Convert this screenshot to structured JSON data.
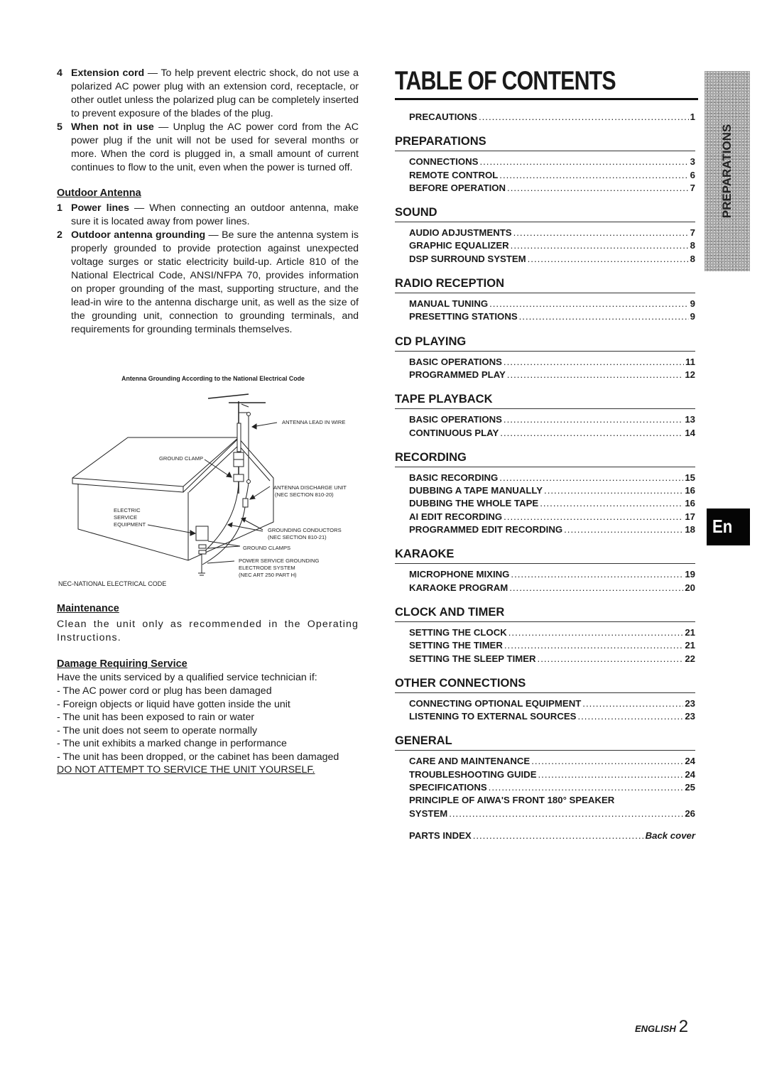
{
  "left": {
    "safety_items": [
      {
        "num": "4",
        "title": "Extension cord",
        "text": " — To help prevent electric shock, do not use a polarized AC power plug with an extension cord, receptacle, or other outlet unless the polarized plug can be completely inserted to prevent exposure of the blades of the plug."
      },
      {
        "num": "5",
        "title": "When not in use",
        "text": " — Unplug the AC power cord from the AC power plug if the unit will not be used for several months or more.  When the cord is plugged in, a small amount of current continues to flow to the unit, even when the power is turned off."
      }
    ],
    "outdoor_antenna": {
      "heading": "Outdoor Antenna",
      "items": [
        {
          "num": "1",
          "title": "Power lines",
          "text": " — When connecting an outdoor antenna, make sure it is located away from power lines."
        },
        {
          "num": "2",
          "title": "Outdoor antenna grounding",
          "text": " — Be sure the antenna system is properly grounded to provide protection against unexpected voltage surges or static electricity build-up.  Article 810 of the National Electrical Code, ANSI/NFPA 70, provides information on proper grounding of the mast, supporting structure, and the lead-in wire to the antenna discharge unit, as well as the size of the grounding unit, connection to grounding terminals, and requirements for grounding terminals themselves."
        }
      ]
    },
    "diagram": {
      "caption": "Antenna Grounding According to the National Electrical Code",
      "labels": {
        "lead_in": "ANTENNA LEAD IN WIRE",
        "ground_clamp": "GROUND CLAMP",
        "discharge_unit_1": "ANTENNA DISCHARGE UNIT",
        "discharge_unit_2": "(NEC SECTION 810-20)",
        "electric_1": "ELECTRIC",
        "electric_2": "SERVICE",
        "electric_3": "EQUIPMENT",
        "conductors_1": "GROUNDING CONDUCTORS",
        "conductors_2": "(NEC SECTION 810-21)",
        "ground_clamps": "GROUND CLAMPS",
        "electrode_1": "POWER SERVICE GROUNDING",
        "electrode_2": "ELECTRODE SYSTEM",
        "electrode_3": "(NEC ART 250 PART H)",
        "nec": "NEC-NATIONAL ELECTRICAL CODE"
      }
    },
    "maintenance": {
      "heading": "Maintenance",
      "text": "Clean the unit only as recommended in the Operating Instructions."
    },
    "damage": {
      "heading": "Damage Requiring Service",
      "intro": "Have the units serviced by a qualified service technician if:",
      "items": [
        "- The AC power cord or plug has been damaged",
        "- Foreign objects or liquid have gotten inside the unit",
        "- The unit has been exposed to rain or water",
        "- The unit does not seem to operate normally",
        "- The unit exhibits a marked change in performance",
        "- The unit has been dropped, or the cabinet has been damaged"
      ],
      "warning": "DO NOT ATTEMPT TO SERVICE THE UNIT YOURSELF."
    }
  },
  "toc": {
    "title": "TABLE OF CONTENTS",
    "precautions": {
      "label": "PRECAUTIONS",
      "page": "1"
    },
    "sections": [
      {
        "heading": "PREPARATIONS",
        "entries": [
          {
            "label": "CONNECTIONS",
            "page": "3"
          },
          {
            "label": "REMOTE CONTROL",
            "page": "6"
          },
          {
            "label": "BEFORE OPERATION",
            "page": "7"
          }
        ]
      },
      {
        "heading": "SOUND",
        "entries": [
          {
            "label": "AUDIO ADJUSTMENTS",
            "page": "7"
          },
          {
            "label": "GRAPHIC EQUALIZER",
            "page": "8"
          },
          {
            "label": "DSP SURROUND SYSTEM",
            "page": "8"
          }
        ]
      },
      {
        "heading": "RADIO RECEPTION",
        "entries": [
          {
            "label": "MANUAL TUNING",
            "page": "9"
          },
          {
            "label": "PRESETTING STATIONS",
            "page": "9"
          }
        ]
      },
      {
        "heading": "CD PLAYING",
        "entries": [
          {
            "label": "BASIC OPERATIONS",
            "page": "11"
          },
          {
            "label": "PROGRAMMED PLAY",
            "page": "12"
          }
        ]
      },
      {
        "heading": "TAPE PLAYBACK",
        "entries": [
          {
            "label": "BASIC OPERATIONS",
            "page": "13"
          },
          {
            "label": "CONTINUOUS PLAY",
            "page": "14"
          }
        ]
      },
      {
        "heading": "RECORDING",
        "entries": [
          {
            "label": "BASIC RECORDING",
            "page": "15"
          },
          {
            "label": "DUBBING A TAPE MANUALLY",
            "page": "16"
          },
          {
            "label": "DUBBING THE WHOLE TAPE",
            "page": "16"
          },
          {
            "label": "AI EDIT RECORDING",
            "page": "17"
          },
          {
            "label": "PROGRAMMED EDIT RECORDING",
            "page": "18"
          }
        ]
      },
      {
        "heading": "KARAOKE",
        "entries": [
          {
            "label": "MICROPHONE MIXING",
            "page": "19"
          },
          {
            "label": "KARAOKE PROGRAM",
            "page": "20"
          }
        ]
      },
      {
        "heading": "CLOCK AND TIMER",
        "entries": [
          {
            "label": "SETTING THE CLOCK",
            "page": "21"
          },
          {
            "label": "SETTING THE TIMER",
            "page": "21"
          },
          {
            "label": "SETTING THE SLEEP TIMER",
            "page": "22"
          }
        ]
      },
      {
        "heading": "OTHER CONNECTIONS",
        "entries": [
          {
            "label": "CONNECTING OPTIONAL EQUIPMENT",
            "page": "23"
          },
          {
            "label": "LISTENING TO EXTERNAL SOURCES",
            "page": "23"
          }
        ]
      }
    ],
    "general": {
      "heading": "GENERAL",
      "entries": [
        {
          "label": "CARE AND MAINTENANCE",
          "page": "24"
        },
        {
          "label": "TROUBLESHOOTING GUIDE",
          "page": "24"
        },
        {
          "label": "SPECIFICATIONS",
          "page": "25"
        }
      ],
      "multiline_label": "PRINCIPLE OF AIWA'S FRONT 180° SPEAKER",
      "multiline_cont": {
        "label": "SYSTEM",
        "page": "26"
      }
    },
    "parts_index": {
      "label": "PARTS INDEX",
      "page": "Back cover"
    }
  },
  "side_tab": {
    "label": "PREPARATIONS"
  },
  "language_tab": {
    "label": "En"
  },
  "footer": {
    "language": "ENGLISH",
    "page_number": "2"
  }
}
